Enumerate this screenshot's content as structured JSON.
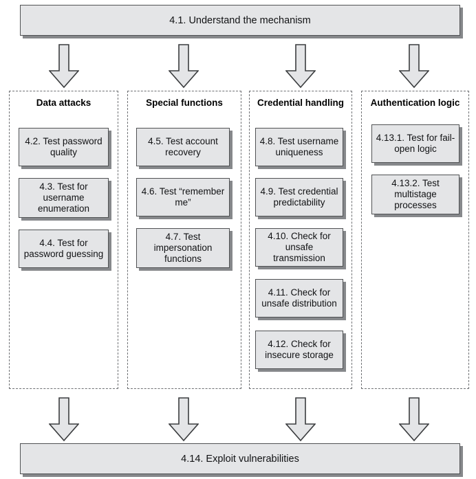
{
  "diagram": {
    "title_box": {
      "label": "4.1. Understand the mechanism"
    },
    "bottom_box": {
      "label": "4.14. Exploit vulnerabilities"
    },
    "colors": {
      "box_fill": "#e4e5e7",
      "box_border": "#4f5153",
      "box_shadow": "#86888b",
      "group_border": "#6d6f72",
      "arrow_fill": "#e4e5e7",
      "arrow_border": "#3a3c3e",
      "text": "#111214",
      "background": "#ffffff"
    },
    "top_arrows": [
      {
        "name": "arrow-top-to-data-attacks"
      },
      {
        "name": "arrow-top-to-special-functions"
      },
      {
        "name": "arrow-top-to-credential-handling"
      },
      {
        "name": "arrow-top-to-authentication-logic"
      }
    ],
    "bottom_arrows": [
      {
        "name": "arrow-data-attacks-to-exploit"
      },
      {
        "name": "arrow-special-functions-to-exploit"
      },
      {
        "name": "arrow-credential-handling-to-exploit"
      },
      {
        "name": "arrow-authentication-logic-to-exploit"
      }
    ],
    "groups": [
      {
        "id": "data-attacks",
        "title": "Data attacks",
        "items": [
          {
            "id": "4.2",
            "label": "4.2. Test password quality"
          },
          {
            "id": "4.3",
            "label": "4.3. Test for username enumeration"
          },
          {
            "id": "4.4",
            "label": "4.4. Test for password guessing"
          }
        ]
      },
      {
        "id": "special-functions",
        "title": "Special functions",
        "items": [
          {
            "id": "4.5",
            "label": "4.5. Test account recovery"
          },
          {
            "id": "4.6",
            "label": "4.6. Test “remember me”"
          },
          {
            "id": "4.7",
            "label": "4.7. Test impersonation functions"
          }
        ]
      },
      {
        "id": "credential-handling",
        "title": "Credential handling",
        "items": [
          {
            "id": "4.8",
            "label": "4.8. Test username uniqueness"
          },
          {
            "id": "4.9",
            "label": "4.9. Test credential predictability"
          },
          {
            "id": "4.10",
            "label": "4.10. Check for unsafe transmission"
          },
          {
            "id": "4.11",
            "label": "4.11. Check for unsafe distribution"
          },
          {
            "id": "4.12",
            "label": "4.12. Check for insecure storage"
          }
        ]
      },
      {
        "id": "authentication-logic",
        "title": "Authentication logic",
        "items": [
          {
            "id": "4.13.1",
            "label": "4.13.1. Test for fail-open logic"
          },
          {
            "id": "4.13.2",
            "label": "4.13.2. Test multistage processes"
          }
        ]
      }
    ]
  }
}
